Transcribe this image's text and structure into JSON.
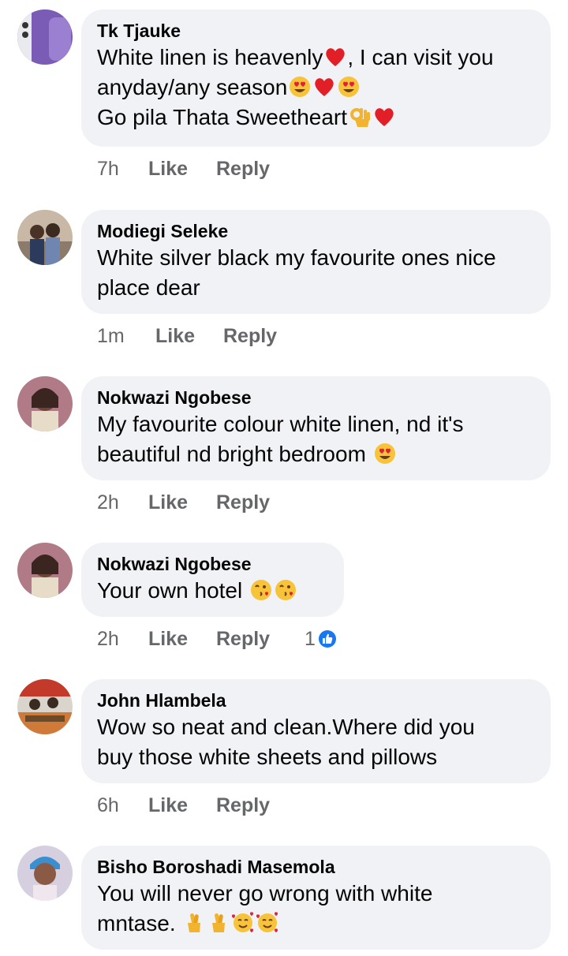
{
  "actions": {
    "like": "Like",
    "reply": "Reply"
  },
  "comments": [
    {
      "author": "Tk Tjauke",
      "lines": [
        "White linen is heavenly",
        ", I can visit you",
        "anyday/any season",
        "Go pila Thata Sweetheart"
      ],
      "time": "7h"
    },
    {
      "author": "Modiegi Seleke",
      "lines": [
        "White silver black my favourite ones nice",
        "place dear"
      ],
      "time": "1m"
    },
    {
      "author": "Nokwazi Ngobese",
      "lines": [
        "My favourite colour white linen, nd it's",
        "beautiful nd bright bedroom"
      ],
      "time": "2h"
    },
    {
      "author": "Nokwazi Ngobese",
      "lines": [
        "Your own hotel"
      ],
      "time": "2h",
      "reaction_count": "1",
      "reaction_icon": "like-thumb-icon"
    },
    {
      "author": "John Hlambela",
      "lines": [
        "Wow so neat and clean.Where did you",
        "buy those white sheets and pillows"
      ],
      "time": "6h"
    },
    {
      "author": "Bisho Boroshadi Masemola",
      "lines": [
        "You will never go wrong with white",
        "mntase."
      ],
      "time": ""
    }
  ],
  "colors": {
    "bubble": "#f0f2f5",
    "meta": "#65676b",
    "like_blue": "#1877f2"
  }
}
